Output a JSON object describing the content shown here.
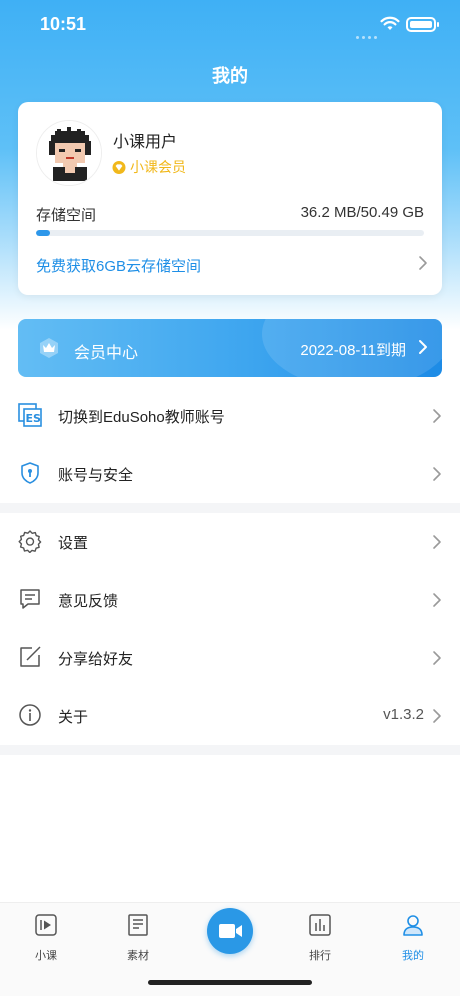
{
  "status_bar": {
    "time": "10:51"
  },
  "header": {
    "title": "我的"
  },
  "profile": {
    "name": "小课用户",
    "member_label": "小课会员",
    "storage_label": "存储空间",
    "storage_value": "36.2 MB/50.49 GB",
    "storage_used_fraction": 0.0007,
    "free_link": "免费获取6GB云存储空间"
  },
  "vip": {
    "title": "会员中心",
    "expire": "2022-08-11到期"
  },
  "menu_group1": [
    {
      "label": "切换到EduSoho教师账号",
      "icon": "edusoho-logo-icon"
    },
    {
      "label": "账号与安全",
      "icon": "shield-icon"
    }
  ],
  "menu_group2": [
    {
      "label": "设置",
      "icon": "gear-icon"
    },
    {
      "label": "意见反馈",
      "icon": "feedback-icon"
    },
    {
      "label": "分享给好友",
      "icon": "share-edit-icon"
    },
    {
      "label": "关于",
      "icon": "info-icon",
      "value": "v1.3.2"
    }
  ],
  "tabbar": {
    "items": [
      {
        "label": "小课",
        "icon": "play-icon"
      },
      {
        "label": "素材",
        "icon": "document-icon"
      },
      {
        "label": "",
        "icon": "video-camera-icon"
      },
      {
        "label": "排行",
        "icon": "bar-chart-icon"
      },
      {
        "label": "我的",
        "icon": "user-icon"
      }
    ],
    "active_index": 4
  },
  "colors": {
    "primary": "#1f8fe6",
    "gold": "#f1b81b",
    "hero_top": "#3fb0f5"
  }
}
